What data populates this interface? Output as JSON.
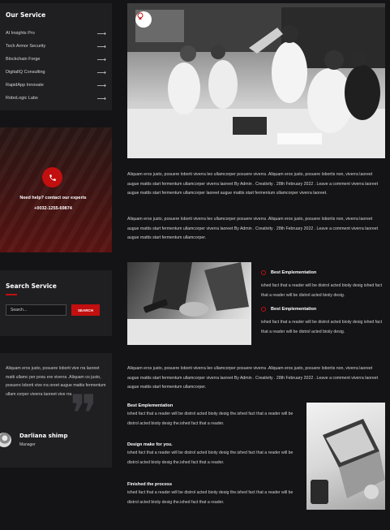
{
  "services": {
    "title": "Our Service",
    "items": [
      {
        "label": "AI Insights Pro"
      },
      {
        "label": "Tech Armor Security"
      },
      {
        "label": "Blockchain Forge"
      },
      {
        "label": "DigitalIQ Consulting"
      },
      {
        "label": "RapidApp Innovate"
      },
      {
        "label": "RoboLogic Labs"
      }
    ],
    "arrow_icon": "arrow-right-icon"
  },
  "help": {
    "text": "Need help? contact our experts",
    "phone": "+0032-1255-69874",
    "icon": "phone-icon",
    "accent": "#c20f0f"
  },
  "search": {
    "title": "Search Service",
    "placeholder": "Search...",
    "button_label": "SEARCH"
  },
  "testimonial": {
    "text": "Aliquam eros justo, posuere loborti vive rra laoreet matti ullamc per posu ere viverra .Aliquam os justo, posuere loborti vive rra oreet augue mattis fermentum ullam corper viverra laoreet vive rra",
    "name": "Darliana shimp",
    "role": "Manager"
  },
  "main": {
    "para1": "Aliquam eros justo, posuere loborti viverra leo ullamcorper posuere viverra .Aliquam eros justo, posuere lobortis non, viverra laoreet augue mattis start fermentum ullamcorper viverra laoreet By Admin . Creativity . 28th February 2022 . Leave a comment viverra laoreet augue mattis start fermentum ullamcorper laoreet augue mattis start fermentum ullamcorper viverra laoreet.",
    "para2": "Aliquam eros justo, posuere loborti viverra leo ullamcorper posuere viverra .Aliquam eros justo, posuere lobortis non, viverra laoreet augue mattis start fermentum ullamcorper viverra laoreet By Admin . Creativity . 28th February 2022 . Leave a comment viverra laoreet augue mattis start fermentum ullamcorper.",
    "features": [
      {
        "title": "Best Emplementation",
        "text": "ished fact that a reader will be distrol acted bioiiy desig ished fact that a reader will be distrol acted bioiiy desig."
      },
      {
        "title": "Best Emplementation",
        "text": "ished fact that a reader will be distrol acted bioiiy desig ished fact that a reader will be distrol acted bioiiy desig."
      }
    ],
    "para3": "Aliquam eros justo, posuere loborti viverra leo ullamcorper posuere viverra .Aliquam eros justo, posuere lobortis non, viverra laoreet augue mattis start fermentum ullamcorper viverra laoreet By Admin . Creativity . 28th February 2022 . Leave a comment viverra laoreet augue mattis start fermentum ullamcorper.",
    "sections": [
      {
        "title": "Best Emplementation",
        "text": "ished fact that a reader will be distrol acted bioiiy desig the.ished fact that a reader will be distrol acted bioiiy desig the.ished fact that a reader."
      },
      {
        "title": "Design make for you.",
        "text": "ished fact that a reader will be distrol acted bioiiy desig the.ished fact that a reader will be distrol acted bioiiy desig the.ished fact that a reader."
      },
      {
        "title": "Finished the process",
        "text": "ished fact that a reader will be distrol acted bioiiy desig the.ished fact that a reader will be distrol acted bioiiy desig the.ished fact that a reader."
      }
    ]
  }
}
